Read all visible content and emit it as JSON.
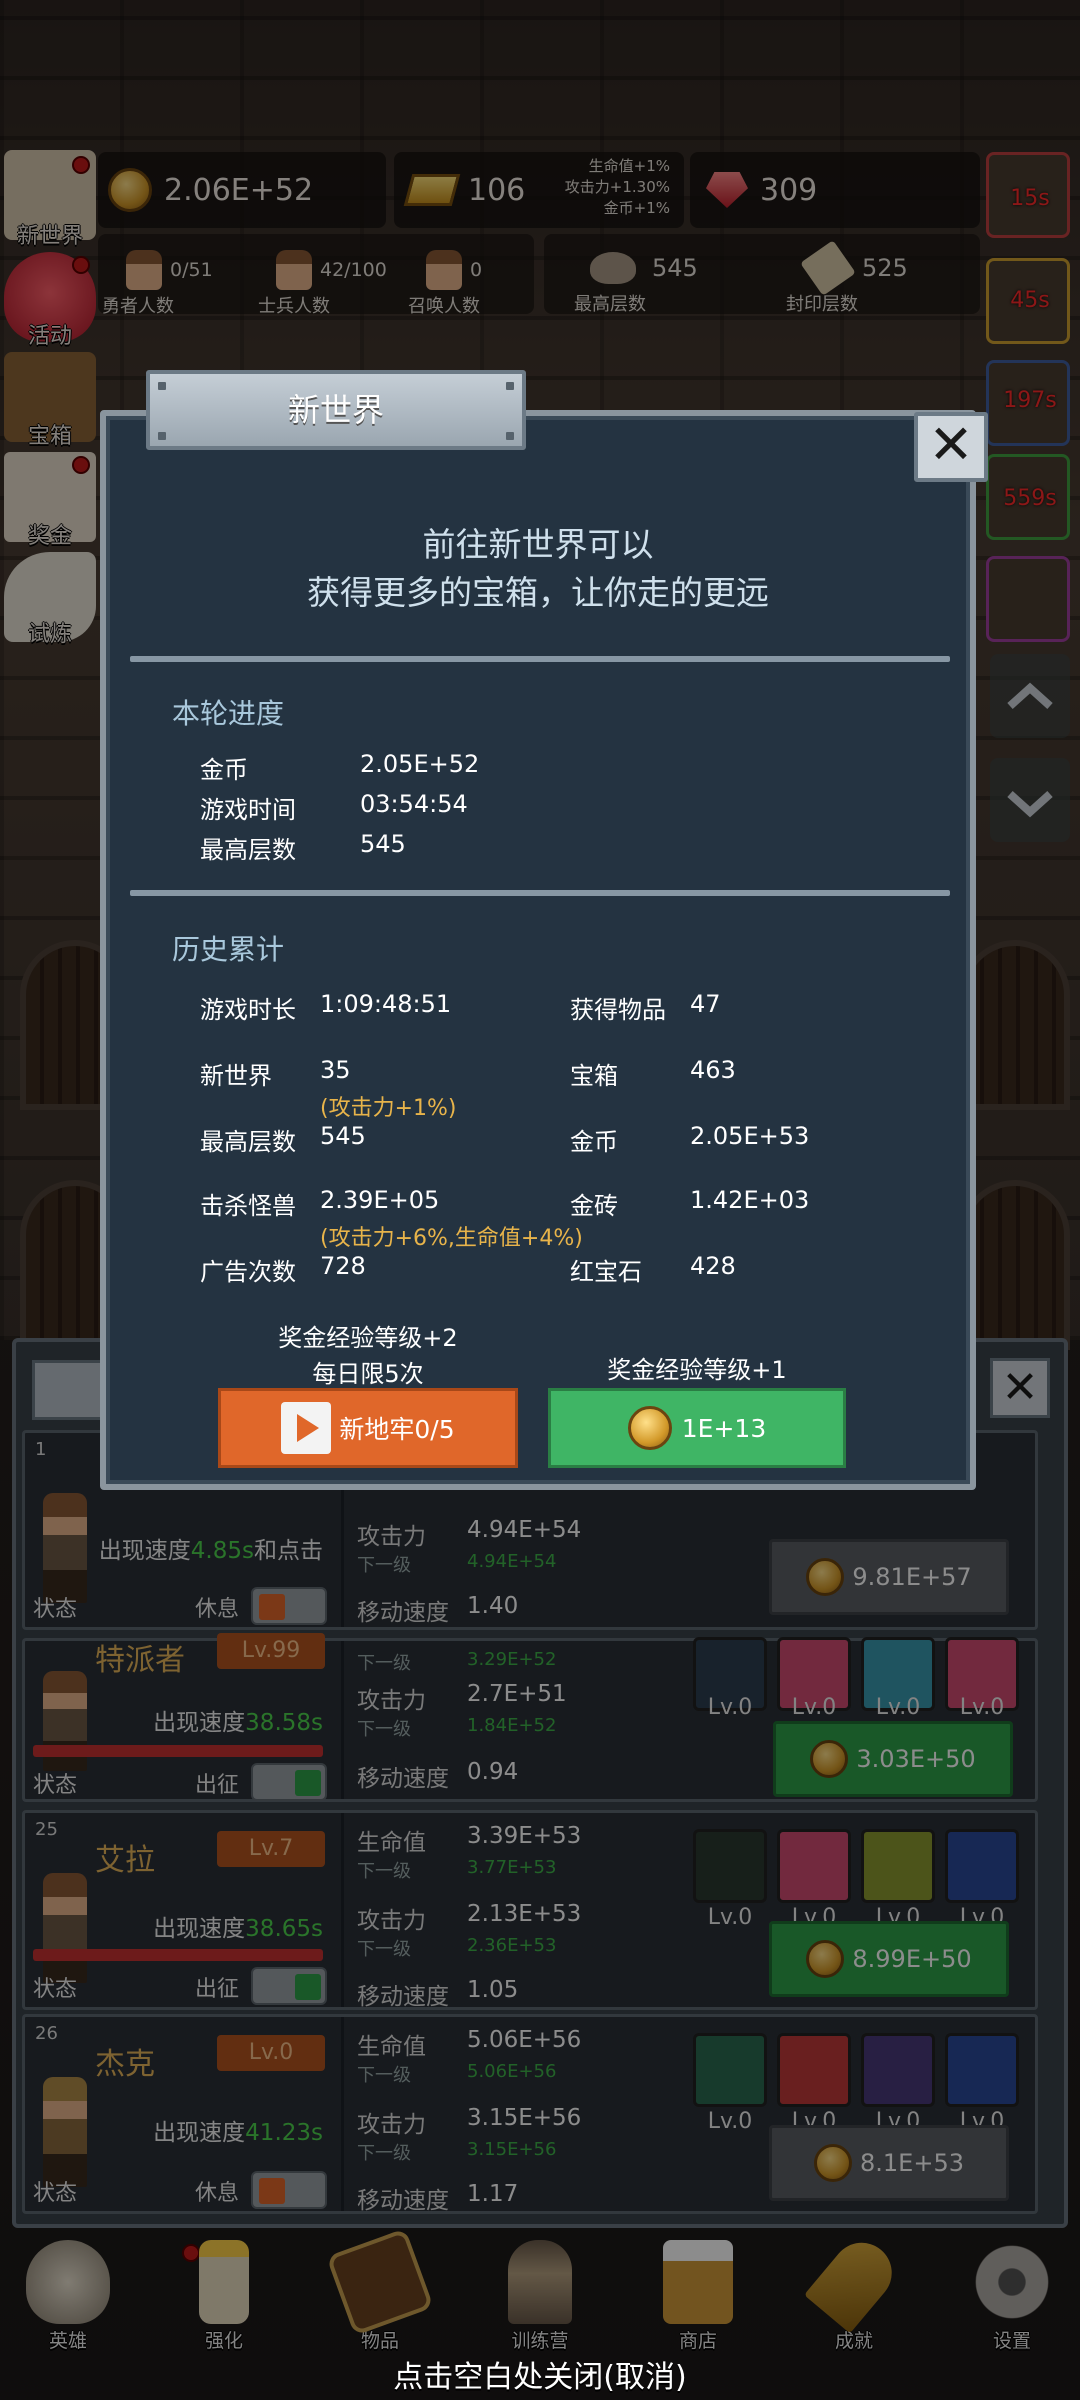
{
  "resources": {
    "gold": "2.06E+52",
    "gold_bars": "106",
    "rubies": "309",
    "bonus_lines": [
      "生命值+1%",
      "攻击力+1.30%",
      "金币+1%"
    ]
  },
  "stats": {
    "heroes": {
      "value": "0/51",
      "label": "勇者人数"
    },
    "soldiers": {
      "value": "42/100",
      "label": "士兵人数"
    },
    "summons": {
      "value": "0",
      "label": "召唤人数"
    },
    "max_floor": {
      "value": "545",
      "label": "最高层数"
    },
    "sealed_floor": {
      "value": "525",
      "label": "封印层数"
    }
  },
  "side_menu": [
    "新世界",
    "活动",
    "宝箱",
    "奖金",
    "试炼"
  ],
  "right_timers": [
    "15s",
    "45s",
    "197s",
    "559s"
  ],
  "modal": {
    "title": "新世界",
    "close_icon": "close-x",
    "intro_line1": "前往新世界可以",
    "intro_line2": "获得更多的宝箱，让你走的更远",
    "round_title": "本轮进度",
    "round_rows": [
      {
        "label": "金币",
        "value": "2.05E+52"
      },
      {
        "label": "游戏时间",
        "value": "03:54:54"
      },
      {
        "label": "最高层数",
        "value": "545"
      }
    ],
    "history_title": "历史累计",
    "history_left": [
      {
        "label": "游戏时长",
        "value": "1:09:48:51"
      },
      {
        "label": "新世界",
        "value": "35",
        "bonus": "(攻击力+1%)"
      },
      {
        "label": "最高层数",
        "value": "545"
      },
      {
        "label": "击杀怪兽",
        "value": "2.39E+05",
        "bonus": "(攻击力+6%,生命值+4%)"
      },
      {
        "label": "广告次数",
        "value": "728"
      }
    ],
    "history_right": [
      {
        "label": "获得物品",
        "value": "47"
      },
      {
        "label": "宝箱",
        "value": "463"
      },
      {
        "label": "金币",
        "value": "2.05E+53"
      },
      {
        "label": "金砖",
        "value": "1.42E+03"
      },
      {
        "label": "红宝石",
        "value": "428"
      }
    ],
    "left_note1": "奖金经验等级+2",
    "left_note2": "每日限5次",
    "right_note": "奖金经验等级+1",
    "btn_dungeon": "新地牢0/5",
    "btn_coin": "1E+13"
  },
  "heroes": [
    {
      "num": "1",
      "speed_prefix": "出现速度",
      "speed": "4.85s",
      "speed_suffix": "和点击",
      "status_label": "状态",
      "status": "休息",
      "atk_label": "攻击力",
      "atk": "4.94E+54",
      "next_label": "下一级",
      "atk_next": "4.94E+54",
      "move_label": "移动速度",
      "move": "1.40",
      "upgrade": "9.81E+57"
    },
    {
      "name": "特派者",
      "level": "Lv.99",
      "speed_prefix": "出现速度",
      "speed": "38.58s",
      "status_label": "状态",
      "status": "出征",
      "hp_next": "3.29E+52",
      "next_label": "下一级",
      "atk_label": "攻击力",
      "atk": "2.7E+51",
      "atk_next": "1.84E+52",
      "move_label": "移动速度",
      "move": "0.94",
      "skills": [
        "Lv.0",
        "Lv.0",
        "Lv.0",
        "Lv.0"
      ],
      "upgrade": "3.03E+50"
    },
    {
      "num": "25",
      "name": "艾拉",
      "level": "Lv.7",
      "speed_prefix": "出现速度",
      "speed": "38.65s",
      "status_label": "状态",
      "status": "出征",
      "hp_label": "生命值",
      "hp": "3.39E+53",
      "hp_next": "3.77E+53",
      "next_label": "下一级",
      "atk_label": "攻击力",
      "atk": "2.13E+53",
      "atk_next": "2.36E+53",
      "move_label": "移动速度",
      "move": "1.05",
      "skills": [
        "Lv.0",
        "Lv.0",
        "Lv.0",
        "Lv.0"
      ],
      "upgrade": "8.99E+50"
    },
    {
      "num": "26",
      "name": "杰克",
      "level": "Lv.0",
      "speed_prefix": "出现速度",
      "speed": "41.23s",
      "status_label": "状态",
      "status": "休息",
      "hp_label": "生命值",
      "hp": "5.06E+56",
      "hp_next": "5.06E+56",
      "next_label": "下一级",
      "atk_label": "攻击力",
      "atk": "3.15E+56",
      "atk_next": "3.15E+56",
      "move_label": "移动速度",
      "move": "1.17",
      "skills": [
        "Lv.0",
        "Lv.0",
        "Lv.0",
        "Lv.0"
      ],
      "upgrade": "8.1E+53"
    }
  ],
  "bottom_nav": [
    "英雄",
    "强化",
    "物品",
    "训练营",
    "商店",
    "成就",
    "设置"
  ],
  "close_hint": "点击空白处关闭(取消)"
}
